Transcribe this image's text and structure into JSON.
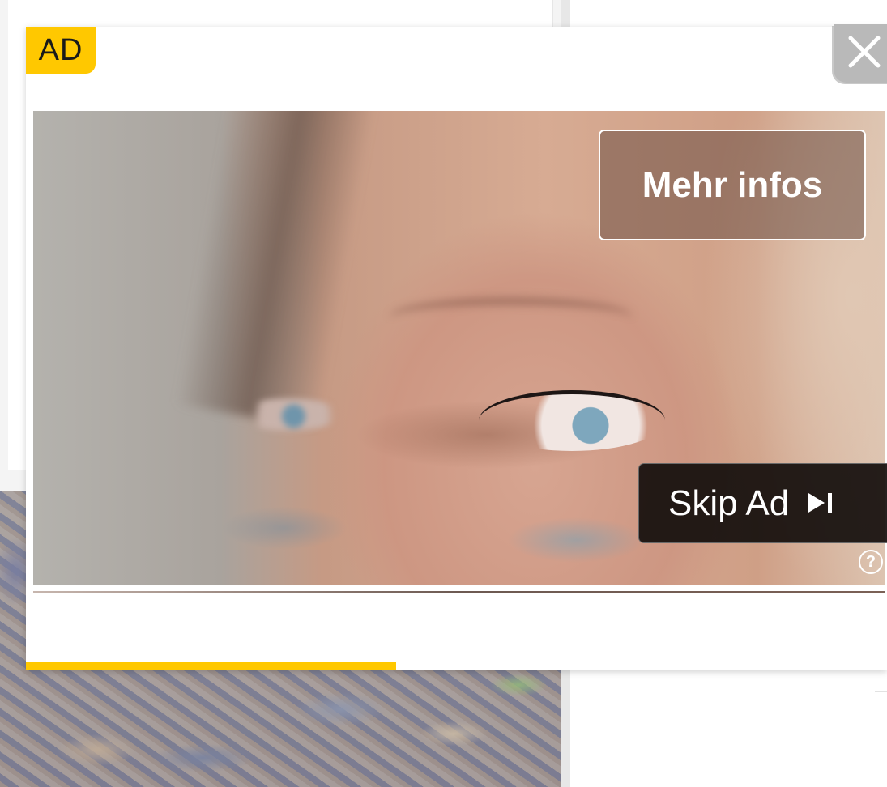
{
  "ad": {
    "badge_label": "AD",
    "more_info_label": "Mehr infos",
    "skip_label": "Skip Ad",
    "help_label": "?",
    "progress_fraction": 0.43
  },
  "colors": {
    "badge_yellow": "#ffc800",
    "progress_yellow": "#ffc800",
    "close_gray": "#b9b9b9"
  },
  "icons": {
    "close": "close-icon",
    "skip": "skip-next-icon",
    "help": "question-circle-icon"
  }
}
